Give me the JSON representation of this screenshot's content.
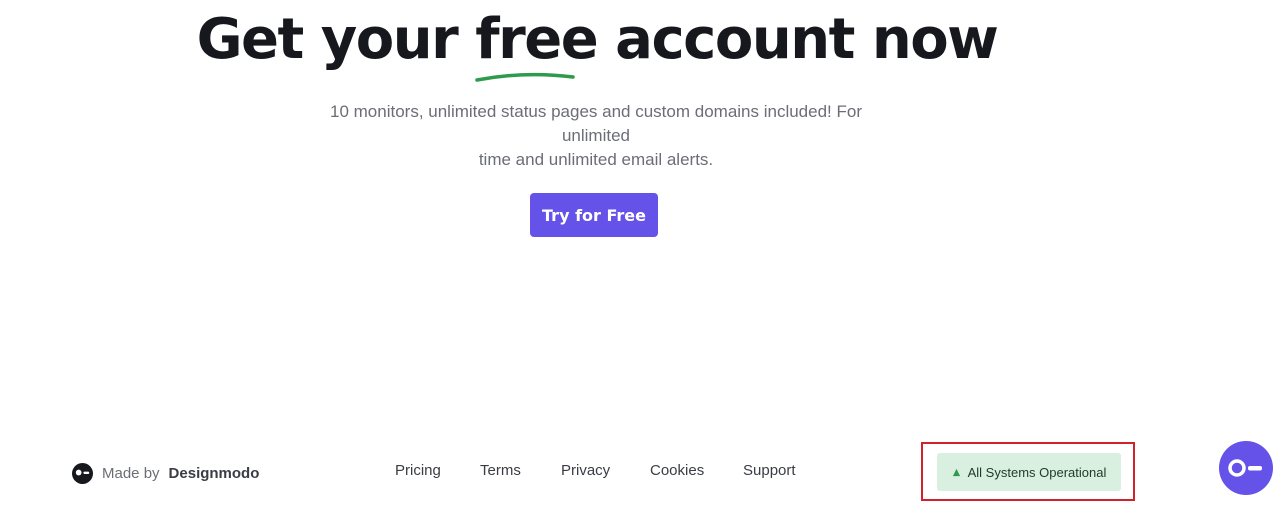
{
  "hero": {
    "title_before": "Get your ",
    "title_accent": "free",
    "title_after": " account now",
    "subtitle_line1": "10 monitors, unlimited status pages and custom domains included! For unlimited",
    "subtitle_line2": "time and unlimited email alerts.",
    "cta_label": "Try for Free"
  },
  "footer": {
    "made_by_prefix": "Made by",
    "made_by_name": "Designmodo",
    "links": [
      "Pricing",
      "Terms",
      "Privacy",
      "Cookies",
      "Support"
    ],
    "status_label": "All Systems Operational"
  },
  "icons": {
    "brand": "designmodo-logo-icon",
    "status": "up-arrow-icon",
    "chat": "chat-support-icon"
  },
  "colors": {
    "accent": "#6452e9",
    "underline": "#2e9a4c",
    "status_bg": "#d9efe0",
    "status_arrow": "#2e9a4c",
    "highlight": "#d0222a"
  }
}
